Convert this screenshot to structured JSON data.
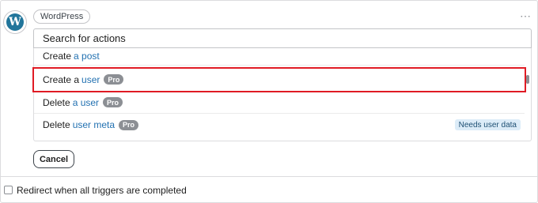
{
  "integration": {
    "logo_letter": "W",
    "name": "WordPress"
  },
  "more_icon": "⋯",
  "search": {
    "placeholder": "Search for actions"
  },
  "actions": [
    {
      "verb": "Create",
      "object": "a post",
      "pro": false
    },
    {
      "verb": "Create a",
      "object": "user",
      "pro": true,
      "pro_label": "Pro",
      "highlighted": true
    },
    {
      "verb": "Delete",
      "object": "a user",
      "pro": true,
      "pro_label": "Pro"
    },
    {
      "verb": "Delete",
      "object": "user meta",
      "pro": true,
      "pro_label": "Pro",
      "badge": "Needs user data"
    }
  ],
  "cancel_label": "Cancel",
  "redirect_checkbox": {
    "label": "Redirect when all triggers are completed",
    "checked": false
  },
  "colors": {
    "link": "#2271b1",
    "highlight": "#e01b24",
    "pro_badge": "#8c8f94",
    "needs_badge": "#dcecf8",
    "wp_brand": "#21759b"
  }
}
